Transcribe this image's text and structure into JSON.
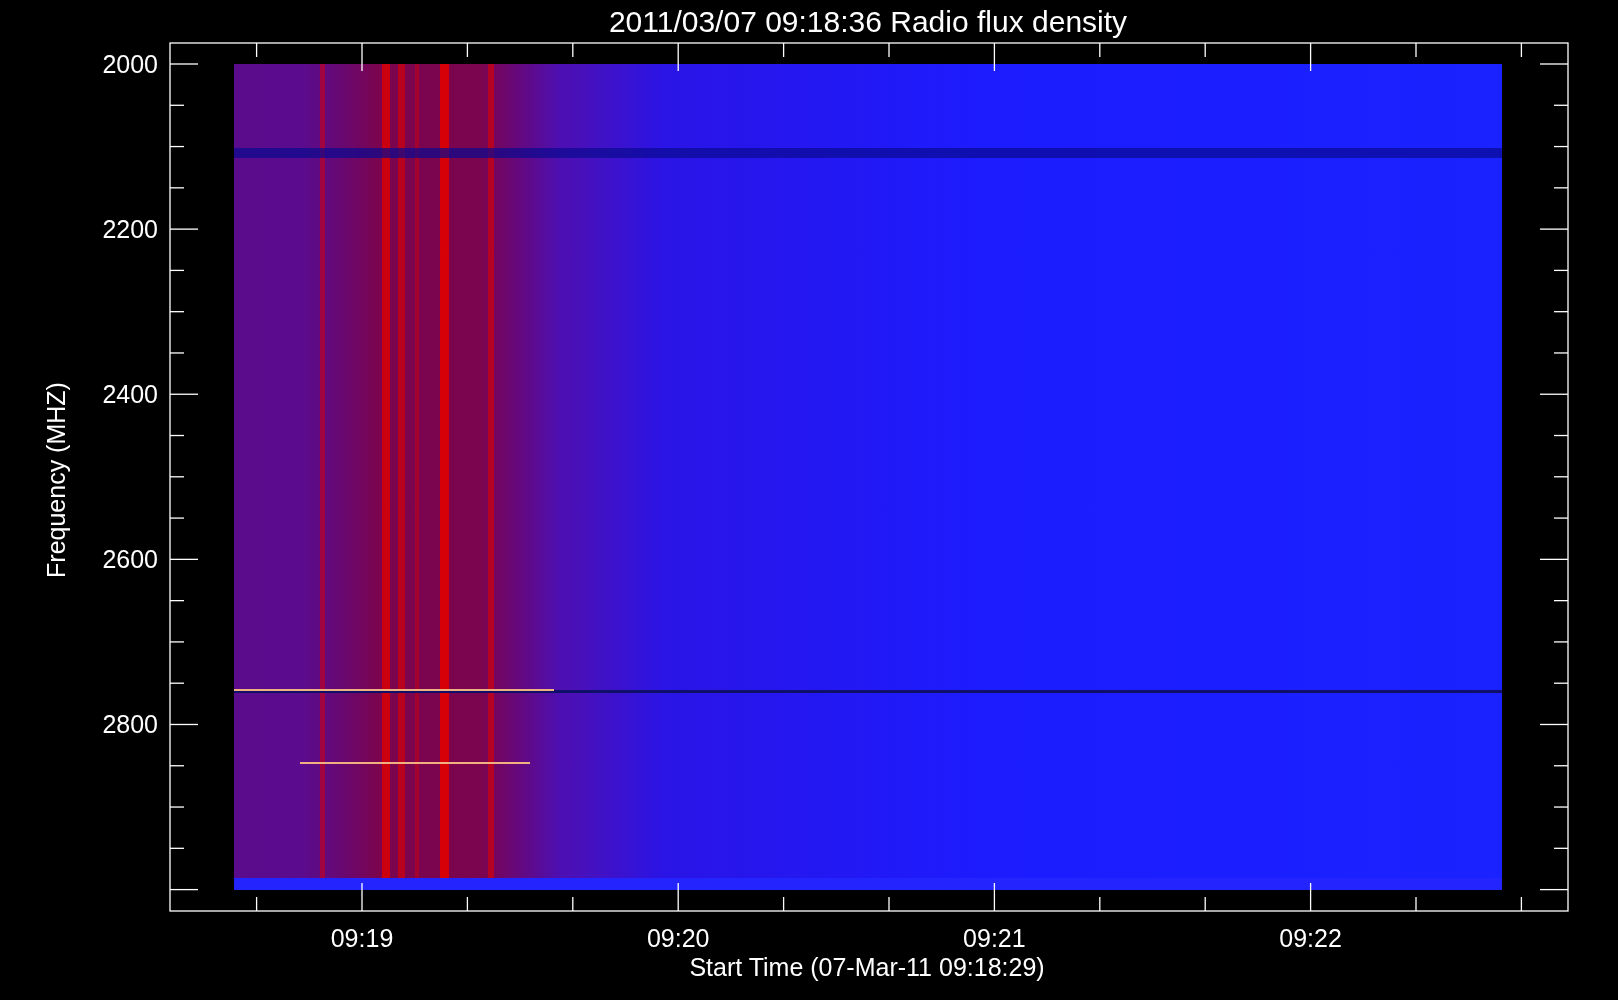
{
  "title": "2011/03/07 09:18:36 Radio flux density",
  "y_axis": {
    "label": "Frequency (MHZ)",
    "ticks": [
      "2000",
      "2200",
      "2400",
      "2600",
      "2800"
    ]
  },
  "x_axis": {
    "label": "Start Time (07-Mar-11 09:18:29)",
    "ticks": [
      "09:19",
      "09:20",
      "09:21",
      "09:22"
    ]
  }
}
